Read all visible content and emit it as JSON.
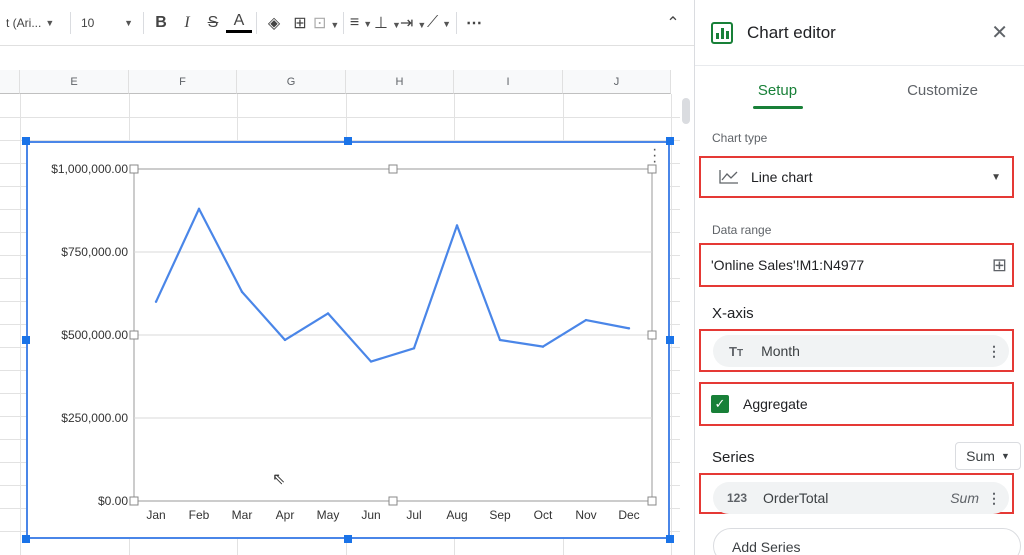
{
  "toolbar": {
    "font": "t (Ari...",
    "font_size": "10",
    "icons": [
      "bold-icon",
      "italic-icon",
      "strikethrough-icon",
      "text-color-icon",
      "fill-color-icon",
      "borders-icon",
      "merge-cells-icon",
      "align-icon",
      "valign-icon",
      "text-wrap-icon",
      "text-rotate-icon",
      "more-icon",
      "collapse-icon"
    ]
  },
  "sheet": {
    "columns": [
      "E",
      "F",
      "G",
      "H",
      "I",
      "J"
    ]
  },
  "chart_data": {
    "type": "line",
    "categories": [
      "Jan",
      "Feb",
      "Mar",
      "Apr",
      "May",
      "Jun",
      "Jul",
      "Aug",
      "Sep",
      "Oct",
      "Nov",
      "Dec"
    ],
    "values": [
      600000,
      880000,
      630000,
      485000,
      565000,
      420000,
      460000,
      830000,
      485000,
      465000,
      545000,
      520000
    ],
    "y_ticks": [
      "$0.00",
      "$250,000.00",
      "$500,000.00",
      "$750,000.00",
      "$1,000,000.00"
    ],
    "ylim": [
      0,
      1000000
    ],
    "line_color": "#4a86e8",
    "grid": true
  },
  "editor": {
    "title": "Chart editor",
    "tabs": [
      {
        "label": "Setup",
        "active": true
      },
      {
        "label": "Customize",
        "active": false
      }
    ],
    "chart_type_label": "Chart type",
    "chart_type_value": "Line chart",
    "data_range_label": "Data range",
    "data_range_value": "'Online Sales'!M1:N4977",
    "x_axis_title": "X-axis",
    "x_axis_field": "Month",
    "aggregate_label": "Aggregate",
    "aggregate_checked": true,
    "series_title": "Series",
    "series_agg": "Sum",
    "series_field": "OrderTotal",
    "series_field_agg": "Sum",
    "add_series": "Add Series",
    "accent_color": "#188038",
    "highlight_color": "#e53935"
  }
}
